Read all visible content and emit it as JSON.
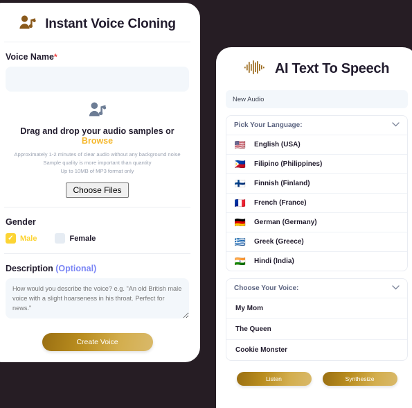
{
  "theme": {
    "page_background": "#261d24",
    "card_background": "#ffffff",
    "gold": "#b98d1f",
    "accent_yellow": "#fcd434",
    "required_red": "#ef4444",
    "optional_purple": "#7b86f5",
    "input_background": "#f3f7fb"
  },
  "voice_cloning": {
    "icon": "person-music-note-icon",
    "title": "Instant Voice Cloning",
    "voice_name": {
      "label": "Voice Name",
      "required_marker": "*",
      "value": "",
      "placeholder": ""
    },
    "dropzone": {
      "icon": "person-music-note-icon",
      "main_text": "Drag and drop your audio samples or",
      "browse_link": "Browse",
      "hints": [
        "Approximately 1-2 minutes of clear audio without any background noise",
        "Sample quality is more important than quantity",
        "Up to 10MB of MP3 format only"
      ],
      "choose_files_label": "Choose Files"
    },
    "gender": {
      "label": "Gender",
      "options": [
        {
          "label": "Male",
          "checked": true,
          "check_glyph": "✓"
        },
        {
          "label": "Female",
          "checked": false,
          "check_glyph": ""
        }
      ]
    },
    "description": {
      "label": "Description",
      "optional_label": "(Optional)",
      "value": "",
      "placeholder": "How would you describe the voice? e.g. \"An old British male voice with a slight hoarseness in his throat. Perfect for news.\""
    },
    "submit_label": "Create Voice"
  },
  "text_to_speech": {
    "icon": "audio-waveform-icon",
    "title": "AI Text To Speech",
    "audio_name": {
      "value": "New Audio",
      "placeholder": "New Audio"
    },
    "language_section": {
      "label": "Pick Your Language:",
      "chevron": "⌄",
      "options": [
        {
          "flag": "🇺🇸",
          "label": "English (USA)"
        },
        {
          "flag": "🇵🇭",
          "label": "Filipino (Philippines)"
        },
        {
          "flag": "🇫🇮",
          "label": "Finnish (Finland)"
        },
        {
          "flag": "🇫🇷",
          "label": "French (France)"
        },
        {
          "flag": "🇩🇪",
          "label": "German (Germany)"
        },
        {
          "flag": "🇬🇷",
          "label": "Greek (Greece)"
        },
        {
          "flag": "🇮🇳",
          "label": "Hindi (India)"
        }
      ]
    },
    "voice_section": {
      "label": "Choose Your Voice:",
      "chevron": "⌄",
      "options": [
        {
          "label": "My Mom"
        },
        {
          "label": "The Queen"
        },
        {
          "label": "Cookie Monster"
        }
      ]
    },
    "actions": [
      {
        "label": "Listen"
      },
      {
        "label": "Synthesize"
      }
    ]
  }
}
